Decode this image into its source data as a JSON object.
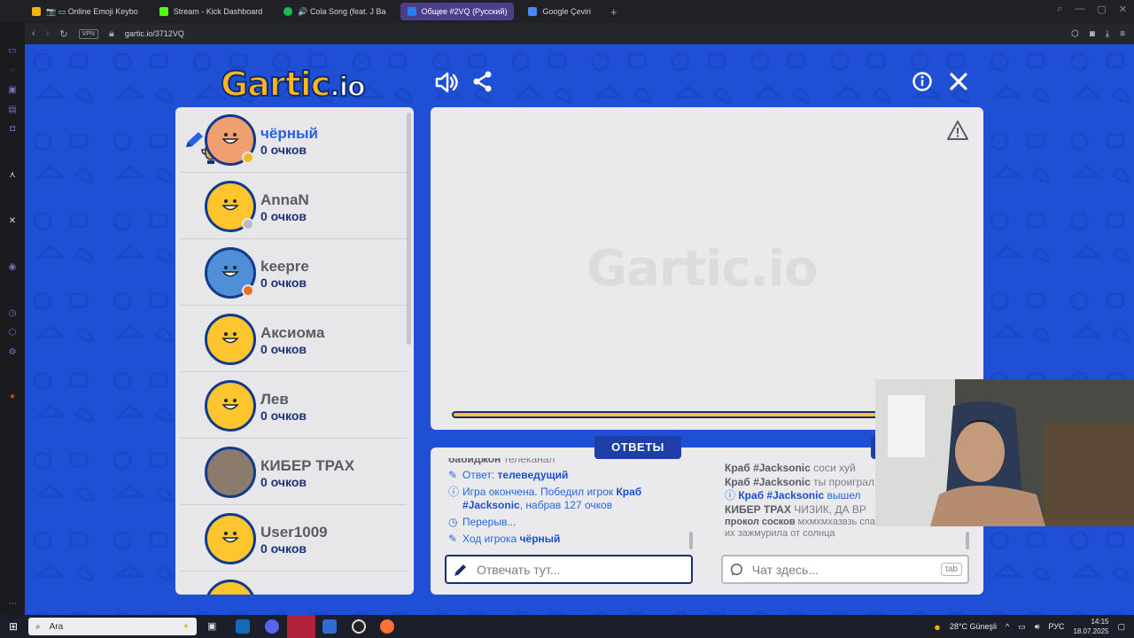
{
  "browser": {
    "tabs": [
      {
        "label": "📷 ▭ Online Emoji Keybo",
        "active": false,
        "color": "#f5b301"
      },
      {
        "label": "Stream - Kick Dashboard",
        "active": false,
        "color": "#53fc18"
      },
      {
        "label": "🔊 Cola Song (feat. J Ba",
        "active": false,
        "color": "#1db954"
      },
      {
        "label": "Общее #2VQ (Русский)",
        "active": true,
        "color": "#2a7cf4"
      },
      {
        "label": "Google Çeviri",
        "active": false,
        "color": "#4a8af4"
      }
    ],
    "new_tab": "+",
    "vpn_badge": "VPN",
    "url": "gartic.io/3712VQ"
  },
  "game": {
    "logo_main": "Gartic",
    "logo_tld": ".io",
    "players": [
      {
        "name": "чёрный",
        "score": "0 очков",
        "current": true,
        "status_color": "#f2b925",
        "drawing": true,
        "trophy": true
      },
      {
        "name": "AnnaN",
        "score": "0 очков",
        "current": false,
        "status_color": "#b8b9be"
      },
      {
        "name": "keepre",
        "score": "0 очков",
        "current": false,
        "status_color": "#e8711f"
      },
      {
        "name": "Аксиома",
        "score": "0 очков",
        "current": false
      },
      {
        "name": "Лев",
        "score": "0 очков",
        "current": false
      },
      {
        "name": "КИБЕР ТРАХ",
        "score": "0 очков",
        "current": false
      },
      {
        "name": "User1009",
        "score": "0 очков",
        "current": false
      }
    ],
    "canvas_watermark": "Gartic.io",
    "timer_fraction": 0.97,
    "answers_label": "ОТВЕТЫ",
    "answers": {
      "first_name": "бабиджон",
      "first_text": "телеканал",
      "answer_prefix": "Ответ:",
      "answer_word": "телеведущий",
      "game_over_text": "Игра окончена. Победил игрок",
      "winner": "Краб #Jacksonic",
      "game_over_suffix": ", набрав 127 очков",
      "break_text": "Перерыв...",
      "turn_text": "Ход игрока",
      "turn_player": "чёрный"
    },
    "chat": {
      "line1_name": "Краб #Jacksonic",
      "line1_text": "соси хуй",
      "line2_name": "Краб #Jacksonic",
      "line2_text": "ты проиграл",
      "line3_name": "Краб #Jacksonic",
      "line3_text": "вышел",
      "line4_name": "КИБЕР ТРАХ",
      "line4_text": "ЧИЗИК, ДА ВР",
      "line5_name": "прокол сосков",
      "line5_text": "мхмхмхазвзь спасибочки, это я еще их зажмурила от солнца"
    },
    "answer_placeholder": "Отвечать тут...",
    "chat_placeholder": "Чат здесь...",
    "tab_hint": "tab"
  },
  "taskbar": {
    "search_label": "Ara",
    "weather": "28°C  Güneşli",
    "lang": "РУС",
    "time": "14:15",
    "date": "18.07.2025"
  }
}
